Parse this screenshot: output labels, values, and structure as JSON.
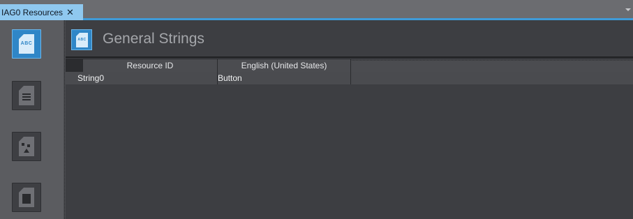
{
  "tabs": [
    {
      "label": "IAG0 Resources",
      "close_glyph": "✕",
      "active": true
    }
  ],
  "rail": {
    "items": [
      {
        "icon": "abc-document-icon",
        "glyph": "ABC",
        "active": true
      },
      {
        "icon": "list-document-icon",
        "active": false
      },
      {
        "icon": "shapes-document-icon",
        "active": false
      },
      {
        "icon": "file-document-icon",
        "active": false
      }
    ]
  },
  "header": {
    "icon": "abc-document-icon",
    "icon_glyph": "ABC",
    "title": "General Strings"
  },
  "table": {
    "columns": [
      "Resource ID",
      "English (United States)"
    ],
    "rows": [
      [
        "String0",
        "Button"
      ]
    ]
  },
  "colors": {
    "accent": "#2f86c7",
    "tab_active": "#8fc8ef",
    "background": "#3d3e42"
  }
}
